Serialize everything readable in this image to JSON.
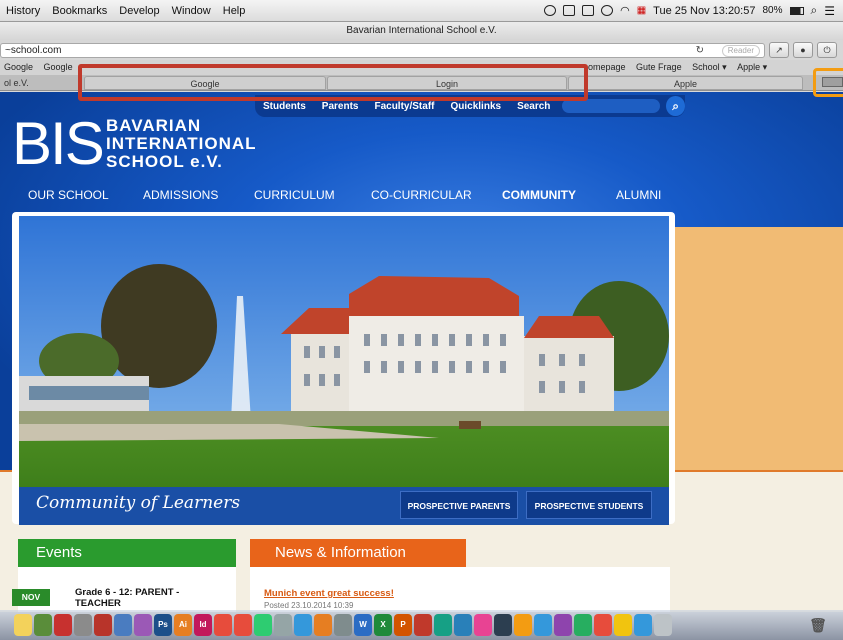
{
  "menubar": {
    "items": [
      "History",
      "Bookmarks",
      "Develop",
      "Window",
      "Help"
    ],
    "clock": "Tue 25 Nov  13:20:57",
    "battery": "80%"
  },
  "window": {
    "title": "Bavarian International School e.V."
  },
  "address": {
    "url": "~school.com",
    "reader": "Reader"
  },
  "bookmarks": {
    "left": [
      "Google",
      "Google"
    ],
    "right": [
      "omepage",
      "Gute Frage",
      "School ▾",
      "Apple ▾"
    ]
  },
  "tabs": {
    "left_label": "ol e.V.",
    "items": [
      "Google",
      "Login",
      "Apple"
    ]
  },
  "site": {
    "topnav": [
      "Students",
      "Parents",
      "Faculty/Staff",
      "Quicklinks",
      "Search"
    ],
    "logo_mark": "BIS",
    "logo_lines": [
      "BAVARIAN",
      "INTERNATIONAL",
      "SCHOOL e.V."
    ],
    "mainnav": [
      "OUR SCHOOL",
      "ADMISSIONS",
      "CURRICULUM",
      "CO-CURRICULAR",
      "COMMUNITY",
      "ALUMNI"
    ],
    "hero_caption": "Community of Learners",
    "buttons": [
      "PROSPECTIVE PARENTS",
      "PROSPECTIVE STUDENTS"
    ],
    "events_title": "Events",
    "news_title": "News & Information",
    "event_month": "NOV",
    "event_text_1": "Grade 6 - 12: PARENT -",
    "event_text_2": "TEACHER",
    "news_link": "Munich event great success!",
    "news_date": "Posted 23.10.2014 10:39"
  },
  "colors": {
    "brand_blue": "#0c48a8",
    "events_green": "#2a9b2e",
    "news_orange": "#e8641a",
    "highlight_red": "#c0392b",
    "highlight_orange": "#f39c12"
  }
}
